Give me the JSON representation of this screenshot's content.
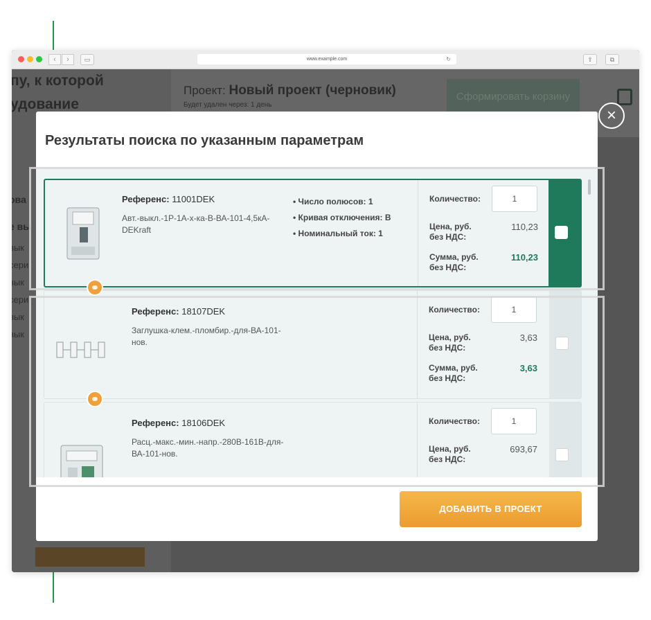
{
  "browser": {
    "url": "www.example.com"
  },
  "background": {
    "heading_line1": "пу, к которой",
    "heading_line2": "удование",
    "subtitle": "ова",
    "subtitle2": "е вы",
    "items": [
      "вык",
      "сери",
      "вык",
      "сери",
      "вык",
      "вык"
    ],
    "project_label": "Проект:",
    "project_name": "Новый проект (черновик)",
    "project_sub": "Будет удален через: 1 день",
    "green_button": "Сформировать корзину"
  },
  "modal": {
    "title": "Результаты поиска по указанным параметрам",
    "labels": {
      "ref": "Референс:",
      "qty": "Количество:",
      "price_line1": "Цена, руб.",
      "price_line2": "без НДС:",
      "sum_line1": "Сумма, руб.",
      "sum_line2": "без НДС:"
    },
    "products": [
      {
        "ref": "11001DEK",
        "desc": "Авт.-выкл.-1Р-1А-х-ка-В-ВА-101-4,5кА-DEKraft",
        "props": [
          "Число полюсов: 1",
          "Кривая отключения: В",
          "Номинальный ток: 1"
        ],
        "qty": "1",
        "price": "110,23",
        "sum": "110,23",
        "selected": true
      },
      {
        "ref": "18107DEK",
        "desc": "Заглушка-клем.-пломбир.-для-ВА-101-нов.",
        "props": [],
        "qty": "1",
        "price": "3,63",
        "sum": "3,63",
        "selected": false
      },
      {
        "ref": "18106DEK",
        "desc": "Расц.-макс.-мин.-напр.-280В-161В-для-ВА-101-нов.",
        "props": [],
        "qty": "1",
        "price": "693,67",
        "sum": "",
        "selected": false
      }
    ],
    "add_button": "ДОБАВИТЬ В ПРОЕКТ"
  },
  "colors": {
    "accent_green": "#1f7a5c",
    "button_orange": "#f0a03a",
    "guide_green": "#1f9a4a"
  }
}
